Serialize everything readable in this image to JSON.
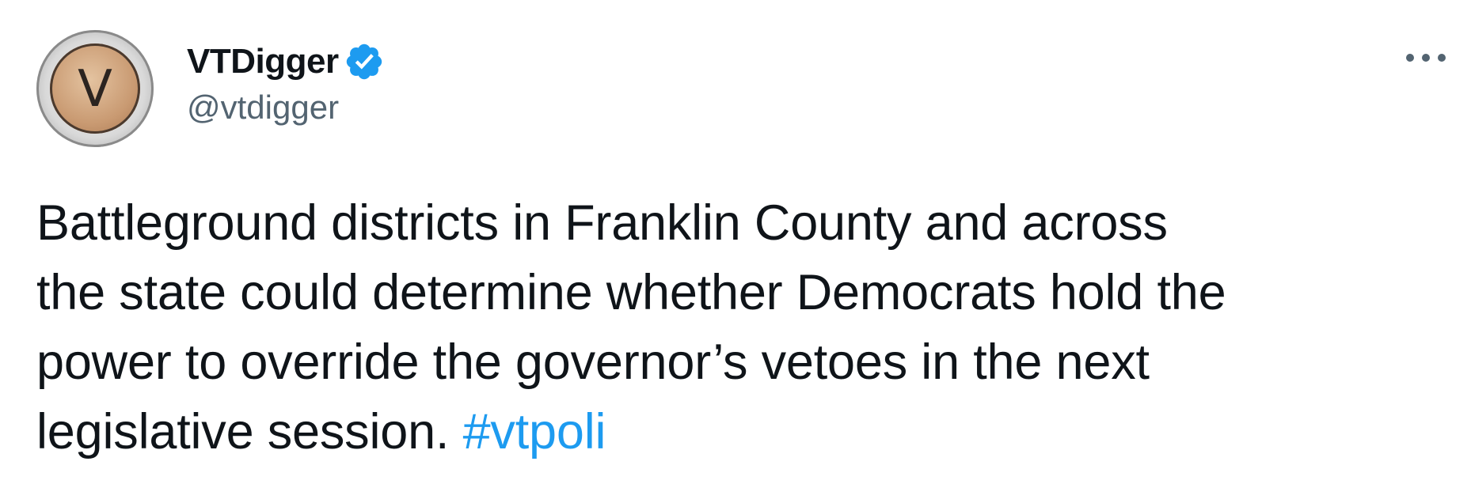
{
  "tweet": {
    "author": {
      "display_name": "VTDigger",
      "handle": "@vtdigger",
      "avatar_letter": "V",
      "verified": true,
      "verified_icon": "verified-badge-icon",
      "verified_color": "#1d9bf0"
    },
    "more_icon": "more-horizontal-icon",
    "text_lines": [
      "Battleground districts in Franklin County and across",
      "the state could determine whether Democrats hold the",
      "power to override the governor’s vetoes in the next",
      "legislative session."
    ],
    "hashtag": "#vtpoli",
    "colors": {
      "text": "#0f1419",
      "secondary": "#536471",
      "link": "#1d9bf0"
    }
  }
}
